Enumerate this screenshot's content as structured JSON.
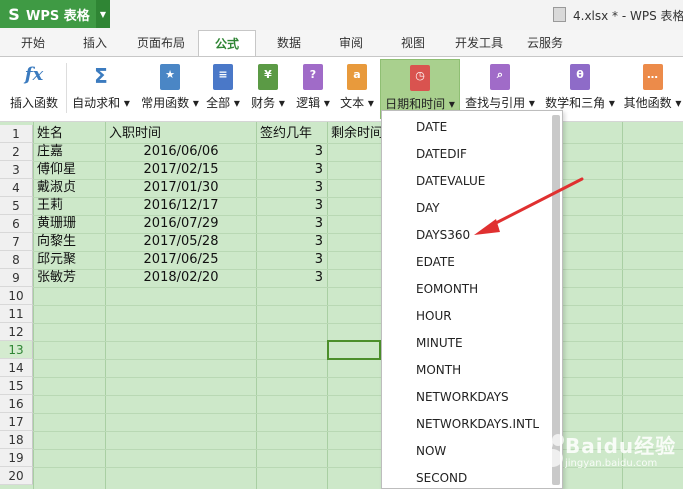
{
  "app": {
    "name": "WPS 表格",
    "logo": "S"
  },
  "window_title": "4.xlsx * - WPS 表格",
  "tabs": [
    "开始",
    "插入",
    "页面布局",
    "公式",
    "数据",
    "审阅",
    "视图",
    "开发工具",
    "云服务"
  ],
  "active_tab": "公式",
  "ribbon": {
    "insert_function": {
      "label": "插入函数",
      "icon": "fx"
    },
    "autosum": {
      "label": "自动求和 ▾",
      "icon": "Σ"
    },
    "common": {
      "label": "常用函数 ▾",
      "icon": "★"
    },
    "all": {
      "label": "全部 ▾",
      "icon": "≡"
    },
    "finance": {
      "label": "财务 ▾",
      "icon": "¥"
    },
    "logic": {
      "label": "逻辑 ▾",
      "icon": "?"
    },
    "text": {
      "label": "文本 ▾",
      "icon": "a"
    },
    "datetime": {
      "label": "日期和时间 ▾",
      "icon": "◷"
    },
    "lookup": {
      "label": "查找与引用 ▾",
      "icon": "⌕"
    },
    "math": {
      "label": "数学和三角 ▾",
      "icon": "θ"
    },
    "other": {
      "label": "其他函数 ▾",
      "icon": "…"
    }
  },
  "icon_colors": {
    "fx": "#3b7bbf",
    "sigma": "#3b7bbf",
    "common": "#3b7bbf",
    "all": "#4a78c8",
    "finance": "#5b9a45",
    "logic": "#9b59b6",
    "text": "#e68a2e",
    "datetime": "#d9534f",
    "lookup": "#9b59b6",
    "math": "#8e44ad",
    "other": "#e67e22"
  },
  "row_numbers": [
    "1",
    "2",
    "3",
    "4",
    "5",
    "6",
    "7",
    "8",
    "9",
    "10",
    "11",
    "12",
    "13",
    "14",
    "15",
    "16",
    "17",
    "18",
    "19",
    "20"
  ],
  "table": {
    "headers": [
      "姓名",
      "入职时间",
      "签约几年",
      "剩余时间"
    ],
    "rows": [
      [
        "庄嘉",
        "2016/06/06",
        "3"
      ],
      [
        "傅仰星",
        "2017/02/15",
        "3"
      ],
      [
        "戴淑贞",
        "2017/01/30",
        "3"
      ],
      [
        "王莉",
        "2016/12/17",
        "3"
      ],
      [
        "黄珊珊",
        "2016/07/29",
        "3"
      ],
      [
        "向黎生",
        "2017/05/28",
        "3"
      ],
      [
        "邱元聚",
        "2017/06/25",
        "3"
      ],
      [
        "张敏芳",
        "2018/02/20",
        "3"
      ]
    ]
  },
  "active_row": "13",
  "dropdown_items": [
    "DATE",
    "DATEDIF",
    "DATEVALUE",
    "DAY",
    "DAYS360",
    "EDATE",
    "EOMONTH",
    "HOUR",
    "MINUTE",
    "MONTH",
    "NETWORKDAYS",
    "NETWORKDAYS.INTL",
    "NOW",
    "SECOND"
  ],
  "highlighted_item": "DAYS360",
  "watermark": {
    "text": "Baidu经验",
    "sub": "jingyan.baidu.com"
  }
}
